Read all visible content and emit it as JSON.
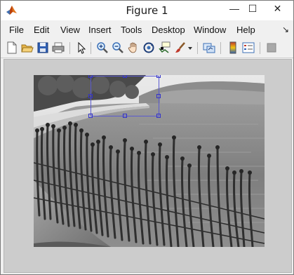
{
  "window": {
    "title": "Figure 1"
  },
  "window_controls": {
    "minimize": "—",
    "maximize": "☐",
    "close": "✕"
  },
  "menubar": {
    "items": [
      "File",
      "Edit",
      "View",
      "Insert",
      "Tools",
      "Desktop",
      "Window",
      "Help"
    ],
    "dock_arrow": "↘"
  },
  "toolbar": {
    "icons": [
      "new-figure-icon",
      "open-file-icon",
      "save-figure-icon",
      "print-figure-icon",
      "edit-plot-icon",
      "zoom-in-icon",
      "zoom-out-icon",
      "pan-icon",
      "rotate-3d-icon",
      "data-cursor-icon",
      "brush-icon",
      "brush-dropdown-icon",
      "link-plot-icon",
      "insert-colorbar-icon",
      "insert-legend-icon",
      "hide-plot-tools-icon"
    ]
  },
  "colors": {
    "roi_outline": "#5a5ad0",
    "roi_handle": "#3333cc",
    "figure_background": "#cccccc"
  }
}
